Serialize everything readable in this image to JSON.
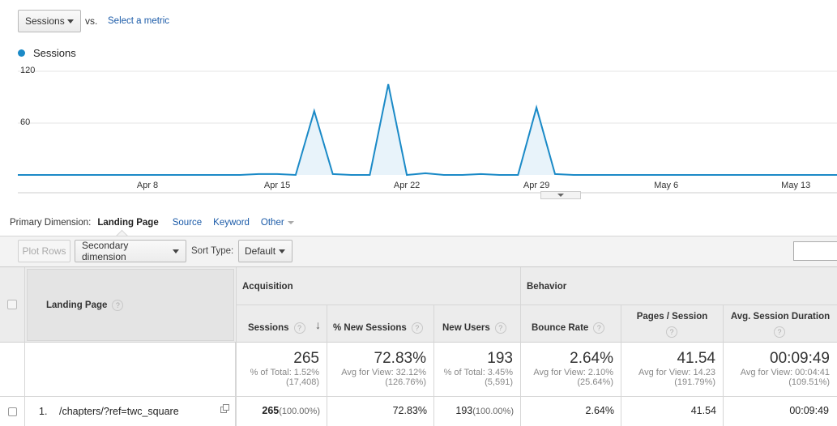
{
  "metric_bar": {
    "metric_select": "Sessions",
    "vs_label": "vs.",
    "select_metric_link": "Select a metric"
  },
  "chart_data": {
    "type": "area",
    "legend": [
      "Sessions"
    ],
    "y_ticks": [
      "120",
      "60"
    ],
    "ylim": [
      0,
      120
    ],
    "x_tick_labels": [
      "Apr 8",
      "Apr 15",
      "Apr 22",
      "Apr 29",
      "May 6",
      "May 13"
    ],
    "color": "#1b8ac7",
    "series": [
      {
        "name": "Sessions",
        "dates": [
          "Apr 1",
          "Apr 2",
          "Apr 3",
          "Apr 4",
          "Apr 5",
          "Apr 6",
          "Apr 7",
          "Apr 8",
          "Apr 9",
          "Apr 10",
          "Apr 11",
          "Apr 12",
          "Apr 13",
          "Apr 14",
          "Apr 15",
          "Apr 16",
          "Apr 17",
          "Apr 18",
          "Apr 19",
          "Apr 20",
          "Apr 21",
          "Apr 22",
          "Apr 23",
          "Apr 24",
          "Apr 25",
          "Apr 26",
          "Apr 27",
          "Apr 28",
          "Apr 29",
          "Apr 30",
          "May 1",
          "May 2",
          "May 3",
          "May 4",
          "May 5",
          "May 6",
          "May 7",
          "May 8",
          "May 9",
          "May 10",
          "May 11",
          "May 12",
          "May 13",
          "May 14",
          "May 15"
        ],
        "values": [
          0,
          0,
          0,
          0,
          0,
          0,
          0,
          0,
          0,
          0,
          0,
          0,
          0,
          1,
          1,
          0,
          74,
          1,
          0,
          0,
          105,
          0,
          2,
          0,
          0,
          1,
          0,
          0,
          78,
          1,
          0,
          0,
          0,
          0,
          0,
          0,
          0,
          0,
          0,
          0,
          0,
          0,
          0,
          0,
          0
        ]
      }
    ]
  },
  "primary_dimension": {
    "label": "Primary Dimension:",
    "active": "Landing Page",
    "options": [
      "Source",
      "Keyword",
      "Other"
    ]
  },
  "toolbar": {
    "plot_rows": "Plot Rows",
    "secondary_dimension": "Secondary dimension",
    "sort_type_label": "Sort Type:",
    "sort_type_value": "Default"
  },
  "table": {
    "landing_page_header": "Landing Page",
    "groups": {
      "acquisition": "Acquisition",
      "behavior": "Behavior"
    },
    "columns": [
      "Sessions",
      "% New Sessions",
      "New Users",
      "Bounce Rate",
      "Pages / Session",
      "Avg. Session Duration"
    ],
    "totals": [
      {
        "value": "265",
        "sub1": "% of Total: 1.52%",
        "sub2": "(17,408)"
      },
      {
        "value": "72.83%",
        "sub1": "Avg for View: 32.12%",
        "sub2": "(126.76%)"
      },
      {
        "value": "193",
        "sub1": "% of Total: 3.45%",
        "sub2": "(5,591)"
      },
      {
        "value": "2.64%",
        "sub1": "Avg for View: 2.10%",
        "sub2": "(25.64%)"
      },
      {
        "value": "41.54",
        "sub1": "Avg for View: 14.23",
        "sub2": "(191.79%)"
      },
      {
        "value": "00:09:49",
        "sub1": "Avg for View: 00:04:41",
        "sub2": "(109.51%)"
      }
    ],
    "row": {
      "index": "1.",
      "page": "/chapters/?ref=twc_square",
      "sessions": "265",
      "sessions_pct": "(100.00%)",
      "new_sessions": "72.83%",
      "new_users": "193",
      "new_users_pct": "(100.00%)",
      "bounce_rate": "2.64%",
      "pages_session": "41.54",
      "avg_duration": "00:09:49"
    }
  }
}
